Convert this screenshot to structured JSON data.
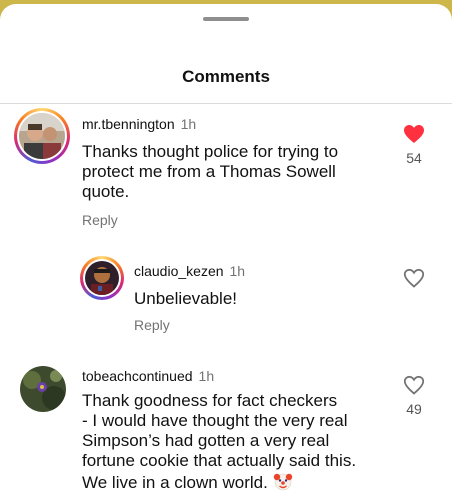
{
  "header": {
    "title": "Comments"
  },
  "comments": [
    {
      "username": "mr.tbennington",
      "time": "1h",
      "text": "Thanks thought police for trying to\nprotect me from a Thomas Sowell\nquote.",
      "reply_label": "Reply",
      "liked": true,
      "likes": "54",
      "avatar_icon": "user-avatar-photo"
    },
    {
      "username": "claudio_kezen",
      "time": "1h",
      "text": "Unbelievable!",
      "reply_label": "Reply",
      "liked": false,
      "likes": "",
      "avatar_icon": "user-avatar-photo"
    },
    {
      "username": "tobeachcontinued",
      "time": "1h",
      "text": "Thank goodness for fact checkers\n- I would have thought the very real\nSimpson’s had gotten a very real\nfortune cookie that actually said this.\nWe live in a clown world.",
      "emoji": "clown-face",
      "liked": false,
      "likes": "49",
      "avatar_icon": "user-avatar-photo"
    }
  ],
  "colors": {
    "like_red": "#ff3040",
    "muted": "#737373",
    "background_top": "#cdb64a"
  }
}
